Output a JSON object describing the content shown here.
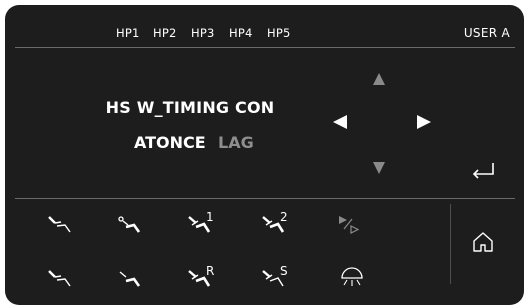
{
  "header": {
    "handpieces": [
      "HP1",
      "HP2",
      "HP3",
      "HP4",
      "HP5"
    ],
    "user": "USER A"
  },
  "main": {
    "title": "HS W_TIMING CON",
    "options": [
      {
        "label": "ATONCE",
        "state": "selected"
      },
      {
        "label": "LAG",
        "state": "unselected"
      }
    ]
  },
  "colors": {
    "background": "#1d1d1d",
    "text": "#ffffff",
    "dimmed": "#8e8e8e",
    "separator": "#6a6a6a"
  },
  "icons": {
    "nav": [
      "arrow-up-icon",
      "arrow-left-icon",
      "arrow-right-icon",
      "arrow-down-icon",
      "enter-icon"
    ],
    "row1": [
      {
        "name": "handpiece-1-icon",
        "label": ""
      },
      {
        "name": "handpiece-2-icon",
        "label": ""
      },
      {
        "name": "handpiece-3-icon",
        "label": "1"
      },
      {
        "name": "handpiece-4-icon",
        "label": "2"
      },
      {
        "name": "play-step-icon",
        "label": ""
      }
    ],
    "row2": [
      {
        "name": "handpiece-5-icon",
        "label": ""
      },
      {
        "name": "handpiece-6-icon",
        "label": ""
      },
      {
        "name": "handpiece-r-icon",
        "label": "R"
      },
      {
        "name": "handpiece-s-icon",
        "label": "S"
      },
      {
        "name": "lamp-icon",
        "label": ""
      }
    ],
    "home": "home-icon"
  }
}
